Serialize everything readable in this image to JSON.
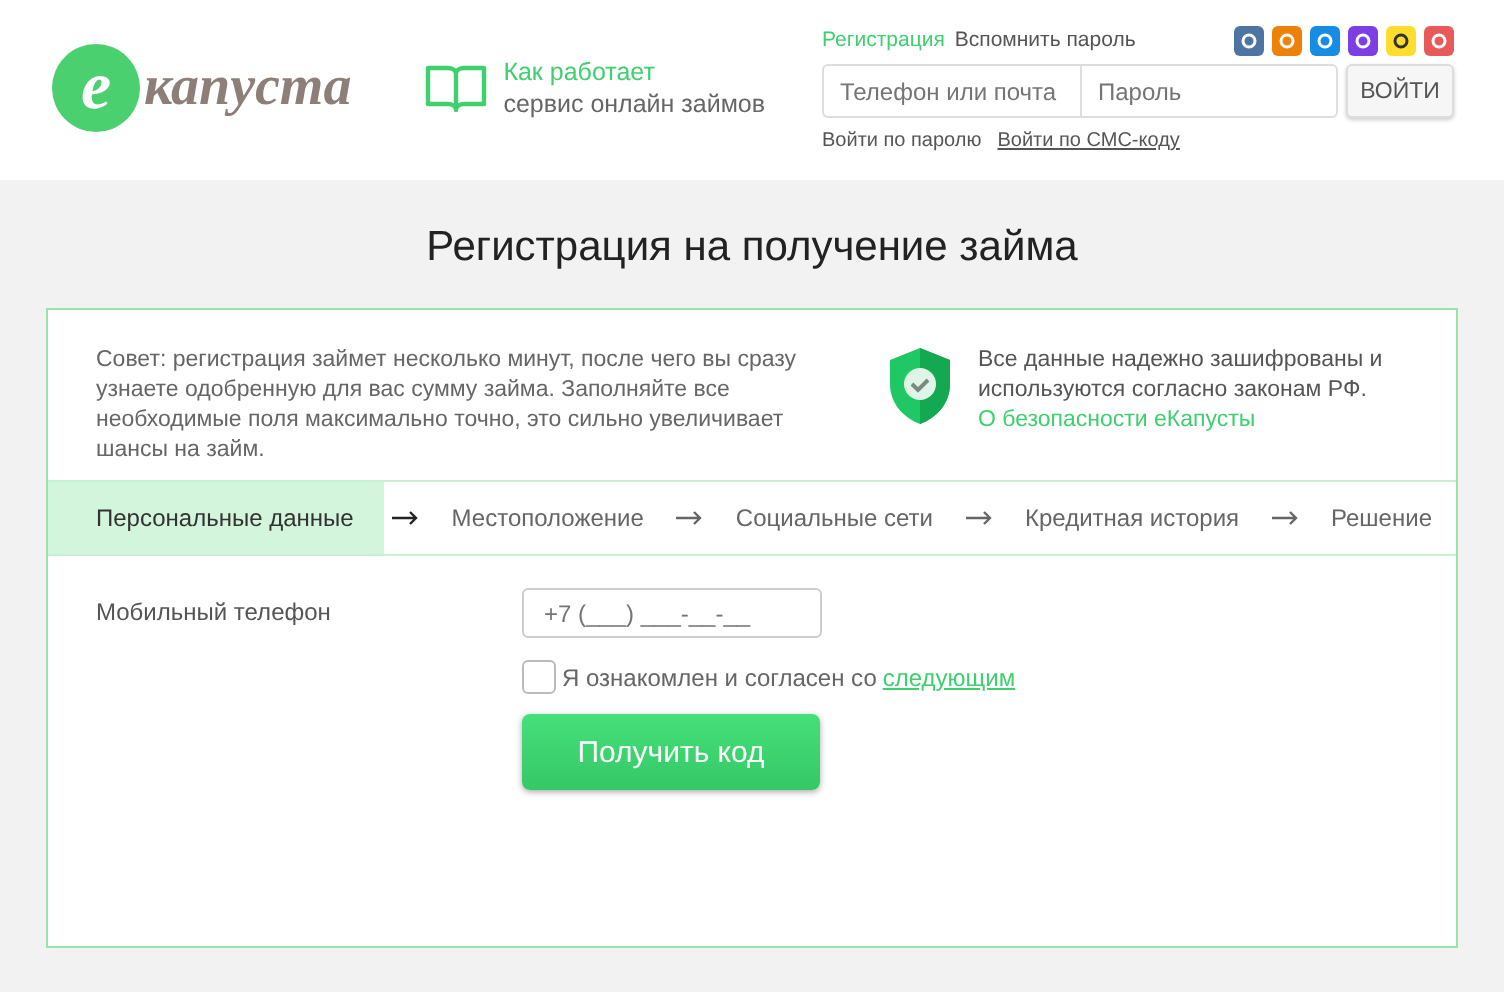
{
  "header": {
    "logo": {
      "letter": "е",
      "word": "капуста"
    },
    "how_it_works": {
      "line1": "Как работает",
      "line2": "сервис онлайн займов"
    },
    "auth_links": [
      {
        "label": "Регистрация",
        "selected": true
      },
      {
        "label": "Вспомнить пароль",
        "selected": false
      }
    ],
    "login": {
      "phone_placeholder": "Телефон или почта",
      "password_placeholder": "Пароль",
      "button": "ВОЙТИ"
    },
    "login_modes": [
      {
        "label": "Войти по паролю",
        "selected": true
      },
      {
        "label": "Войти по СМС-коду",
        "selected": false
      }
    ],
    "social": [
      {
        "color": "#4c75a3"
      },
      {
        "color": "#ee8208"
      },
      {
        "color": "#168de2"
      },
      {
        "color": "#7b3fe4"
      },
      {
        "color": "#ffdd2d"
      },
      {
        "color": "#e85a5a"
      }
    ]
  },
  "page_title": "Регистрация на получение займа",
  "tip": "Совет: регистрация займет несколько минут, после чего вы сразу узнаете одобренную для вас сумму займа. Заполняйте все необходимые поля максимально точно, это сильно увеличивает шансы на займ.",
  "security": {
    "text": "Все данные надежно зашифрованы и используются согласно законам РФ.",
    "link": "О безопасности еКапусты"
  },
  "steps": [
    {
      "label": "Персональные данные",
      "selected": true
    },
    {
      "label": "Местоположение",
      "selected": false
    },
    {
      "label": "Социальные сети",
      "selected": false
    },
    {
      "label": "Кредитная история",
      "selected": false
    },
    {
      "label": "Решение",
      "selected": false
    }
  ],
  "form": {
    "phone_label": "Мобильный телефон",
    "phone_placeholder": "+7 (___) ___-__-__",
    "agree_text": "Я ознакомлен и согласен со",
    "agree_link": "следующим",
    "agree_checked": false,
    "submit": "Получить код"
  }
}
